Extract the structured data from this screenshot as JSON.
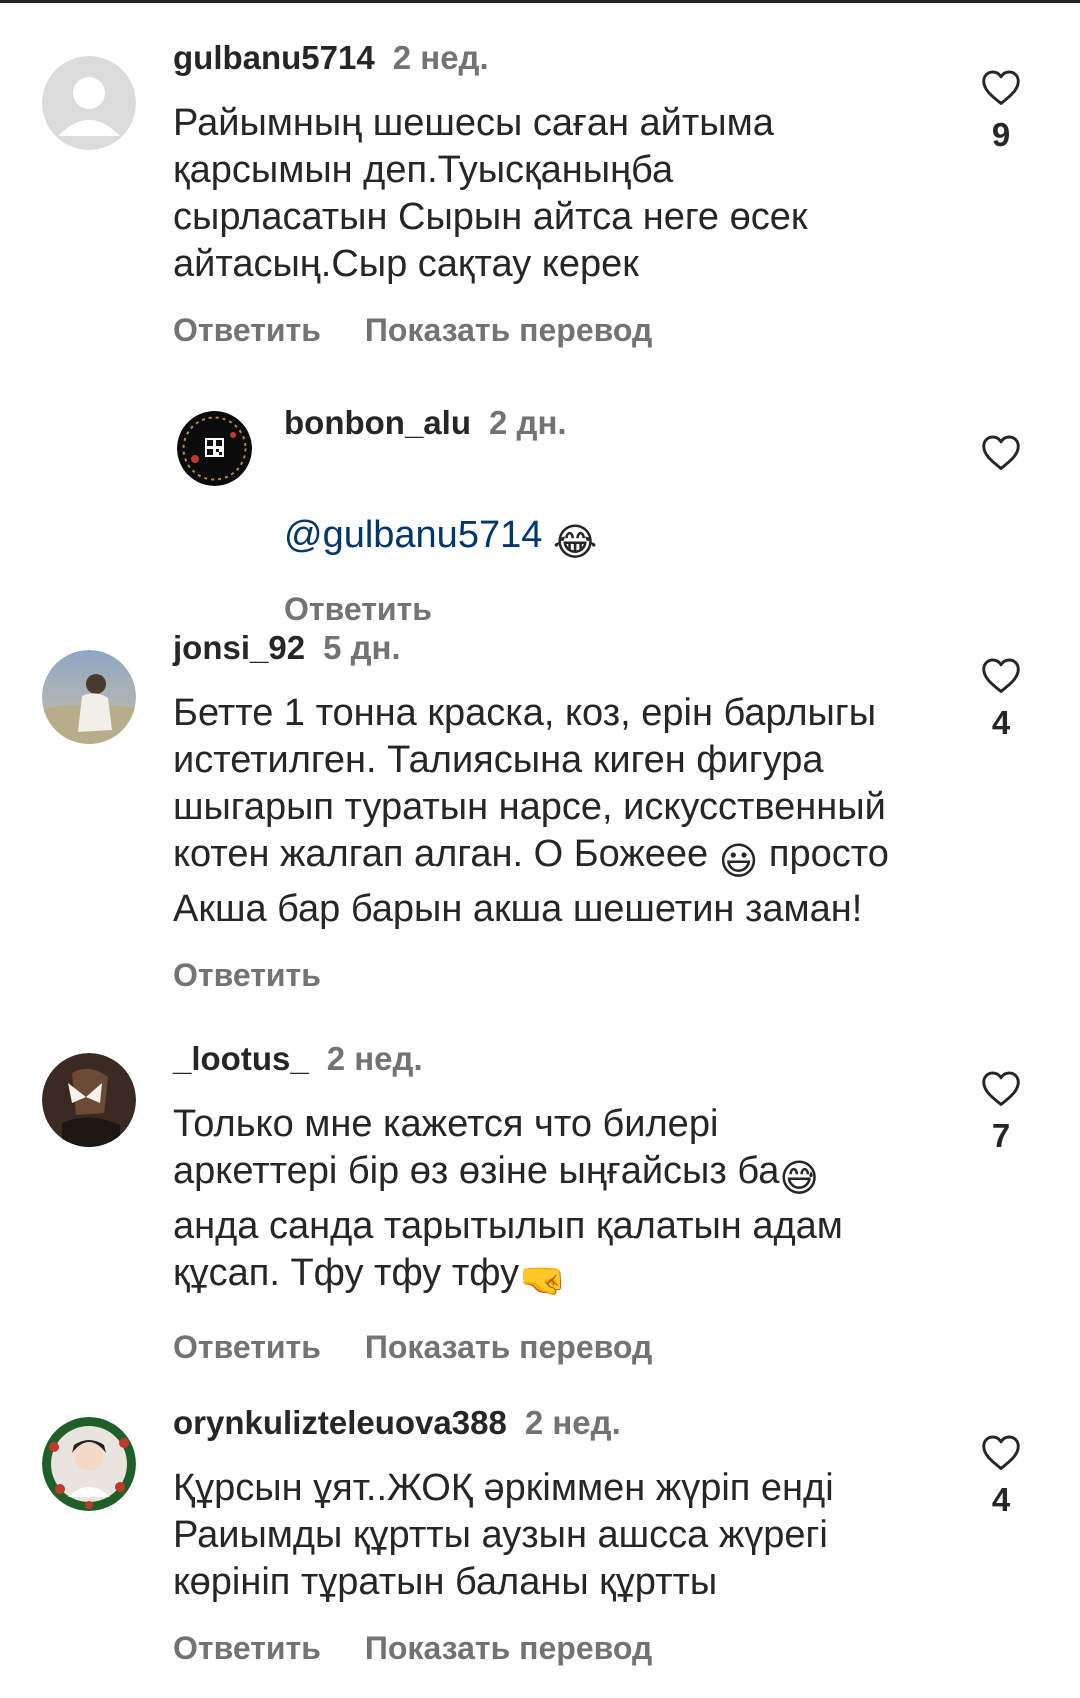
{
  "comments": [
    {
      "username": "gulbanu5714",
      "time": "2 нед.",
      "text": "Райымның шешесы саған айтыма\nқарсымын деп.Туысқаныңба\nсырласатын Сырын айтса неге өсек\nайтасың.Сыр сақтау керек",
      "likes": "9",
      "reply_label": "Ответить",
      "translate_label": "Показать перевод"
    },
    {
      "username": "bonbon_alu",
      "time": "2 дн.",
      "mention": "@gulbanu5714",
      "emoji": "😂",
      "reply_label": "Ответить"
    },
    {
      "username": "jonsi_92",
      "time": "5 дн.",
      "text_a": "Бетте 1 тонна краска, коз, ерін барлыгы\nистетилген. Талиясына киген фигура\nшыгарып туратын нарсе, искусственный\nкотен жалгап алган. О Божеее ",
      "emoji": "😃",
      "text_b": " просто\nАкша бар барын акша шешетин заман!",
      "likes": "4",
      "reply_label": "Ответить"
    },
    {
      "username": "_lootus_",
      "time": "2 нед.",
      "text_a": "Только мне кажется что билері\nаркеттері бір өз өзіне ыңғайсыз ба",
      "emoji_a": "😅",
      "text_b": "\nанда санда тарытылып қалатын адам\nқұсап. Тфу тфу тфу",
      "emoji_b": "🤜",
      "likes": "7",
      "reply_label": "Ответить",
      "translate_label": "Показать перевод"
    },
    {
      "username": "orynkulizteleuova388",
      "time": "2 нед.",
      "text": "Құрсын  ұят..ЖОҚ  әркіммен  жүріп  енді\nРаиымды құртты аузын  ашсса  жүрегі\nкөрініп тұратын  баланы құртты",
      "likes": "4",
      "reply_label": "Ответить",
      "translate_label": "Показать перевод"
    }
  ]
}
